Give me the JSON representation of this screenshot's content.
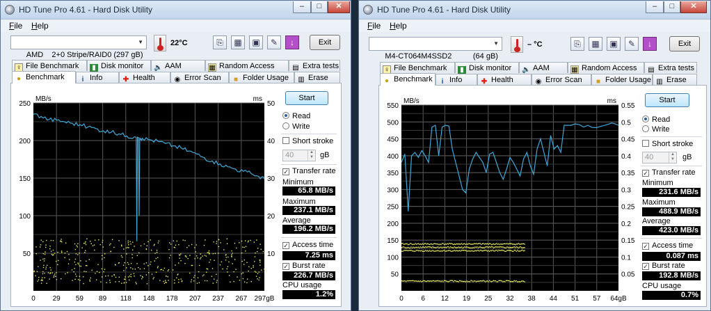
{
  "left": {
    "title": "HD Tune Pro 4.61 - Hard Disk Utility",
    "menu": [
      "File",
      "Help"
    ],
    "drive": "AMD    2+0 Stripe/RAID0 (297 gB)",
    "temperature": "22°C",
    "exit_label": "Exit",
    "tabs_row1": [
      "File Benchmark",
      "Disk monitor",
      "AAM",
      "Random Access",
      "Extra tests"
    ],
    "tabs_row2": [
      "Benchmark",
      "Info",
      "Health",
      "Error Scan",
      "Folder Usage",
      "Erase"
    ],
    "active_tab": "Benchmark",
    "start_label": "Start",
    "read_label": "Read",
    "write_label": "Write",
    "selected_mode": "Read",
    "short_stroke_label": "Short stroke",
    "short_stroke_checked": false,
    "short_stroke_value": "40",
    "short_stroke_unit": "gB",
    "transfer_rate_label": "Transfer rate",
    "transfer_rate_checked": true,
    "minimum_label": "Minimum",
    "minimum": "65.8 MB/s",
    "maximum_label": "Maximum",
    "maximum": "237.1 MB/s",
    "average_label": "Average",
    "average": "196.2 MB/s",
    "access_time_label": "Access time",
    "access_time_checked": true,
    "access_time": "7.25 ms",
    "burst_rate_label": "Burst rate",
    "burst_rate_checked": true,
    "burst_rate": "226.7 MB/s",
    "cpu_label": "CPU usage",
    "cpu": "1.2%"
  },
  "right": {
    "title": "HD Tune Pro 4.61 - Hard Disk Utility",
    "menu": [
      "File",
      "Help"
    ],
    "drive": "M4-CT064M4SSD2          (64 gB)",
    "temperature": "– °C",
    "exit_label": "Exit",
    "tabs_row1": [
      "File Benchmark",
      "Disk monitor",
      "AAM",
      "Random Access",
      "Extra tests"
    ],
    "tabs_row2": [
      "Benchmark",
      "Info",
      "Health",
      "Error Scan",
      "Folder Usage",
      "Erase"
    ],
    "active_tab": "Benchmark",
    "start_label": "Start",
    "read_label": "Read",
    "write_label": "Write",
    "selected_mode": "Read",
    "short_stroke_label": "Short stroke",
    "short_stroke_checked": false,
    "short_stroke_value": "40",
    "short_stroke_unit": "gB",
    "transfer_rate_label": "Transfer rate",
    "transfer_rate_checked": true,
    "minimum_label": "Minimum",
    "minimum": "231.6 MB/s",
    "maximum_label": "Maximum",
    "maximum": "488.9 MB/s",
    "average_label": "Average",
    "average": "423.0 MB/s",
    "access_time_label": "Access time",
    "access_time_checked": true,
    "access_time": "0.087 ms",
    "burst_rate_label": "Burst rate",
    "burst_rate_checked": true,
    "burst_rate": "192.8 MB/s",
    "cpu_label": "CPU usage",
    "cpu": "0.7%"
  },
  "colors": {
    "line": "#3fa9d9",
    "access": "#f0f060",
    "grid": "#5a5a5a",
    "plot_bg": "#000000"
  },
  "chart_data": [
    {
      "type": "line",
      "ylabel": "MB/s",
      "y2label": "ms",
      "yticks": [
        50,
        100,
        150,
        200,
        250
      ],
      "y2ticks": [
        10,
        20,
        30,
        40,
        50
      ],
      "ylim": [
        0,
        250
      ],
      "y2lim": [
        0,
        50
      ],
      "xticks": [
        "0",
        "29",
        "59",
        "89",
        "118",
        "148",
        "178",
        "207",
        "237",
        "267",
        "297gB"
      ],
      "xlim": [
        0,
        297
      ],
      "grid": true,
      "series": [
        {
          "x": [
            0,
            10,
            20,
            30,
            40,
            50,
            60,
            70,
            80,
            90,
            100,
            110,
            120,
            130,
            140,
            150,
            160,
            170,
            180,
            190,
            200,
            210,
            220,
            230,
            240,
            250,
            260,
            270,
            280,
            290,
            297
          ],
          "values": [
            235,
            232,
            228,
            227,
            225,
            223,
            221,
            218,
            216,
            213,
            211,
            209,
            206,
            205,
            203,
            201,
            199,
            196,
            193,
            190,
            186,
            182,
            177,
            173,
            169,
            165,
            162,
            159,
            156,
            152,
            149
          ]
        }
      ],
      "dips": [
        {
          "x": 133,
          "value": 65.8
        },
        {
          "x": 136,
          "value": 100
        }
      ],
      "access_time_ms": {
        "range": [
          2,
          14
        ],
        "typical": 7.25
      }
    },
    {
      "type": "line",
      "ylabel": "MB/s",
      "y2label": "ms",
      "yticks": [
        50,
        100,
        150,
        200,
        250,
        300,
        350,
        400,
        450,
        500,
        550
      ],
      "y2ticks": [
        0.05,
        0.1,
        0.15,
        0.2,
        0.25,
        0.3,
        0.35,
        0.4,
        0.45,
        0.5,
        0.55
      ],
      "ylim": [
        0,
        550
      ],
      "y2lim": [
        0,
        0.55
      ],
      "xticks": [
        "0",
        "6",
        "12",
        "19",
        "25",
        "32",
        "38",
        "44",
        "51",
        "57",
        "64gB"
      ],
      "xlim": [
        0,
        64
      ],
      "grid": true,
      "series": [
        {
          "x": [
            0,
            1,
            2,
            3,
            4,
            5,
            6,
            7,
            8,
            9,
            10,
            11,
            12,
            13,
            14,
            15,
            16,
            17,
            18,
            19,
            20,
            21,
            22,
            23,
            24,
            25,
            26,
            27,
            28,
            29,
            30,
            31,
            32,
            33,
            34,
            35,
            36,
            37,
            38,
            39,
            40,
            41,
            42,
            43,
            44,
            45,
            46,
            47,
            48,
            49,
            50,
            55,
            60,
            64
          ],
          "values": [
            380,
            405,
            235,
            400,
            410,
            395,
            415,
            400,
            380,
            485,
            490,
            400,
            485,
            490,
            488,
            420,
            380,
            340,
            300,
            290,
            360,
            390,
            410,
            395,
            380,
            350,
            405,
            410,
            380,
            350,
            330,
            360,
            395,
            380,
            360,
            340,
            390,
            410,
            370,
            345,
            420,
            450,
            410,
            370,
            460,
            420,
            430,
            410,
            490,
            490,
            490,
            490,
            490,
            490
          ]
        }
      ],
      "access_time_ms": {
        "levels": [
          0.14,
          0.13,
          0.12,
          0.03
        ]
      }
    }
  ]
}
